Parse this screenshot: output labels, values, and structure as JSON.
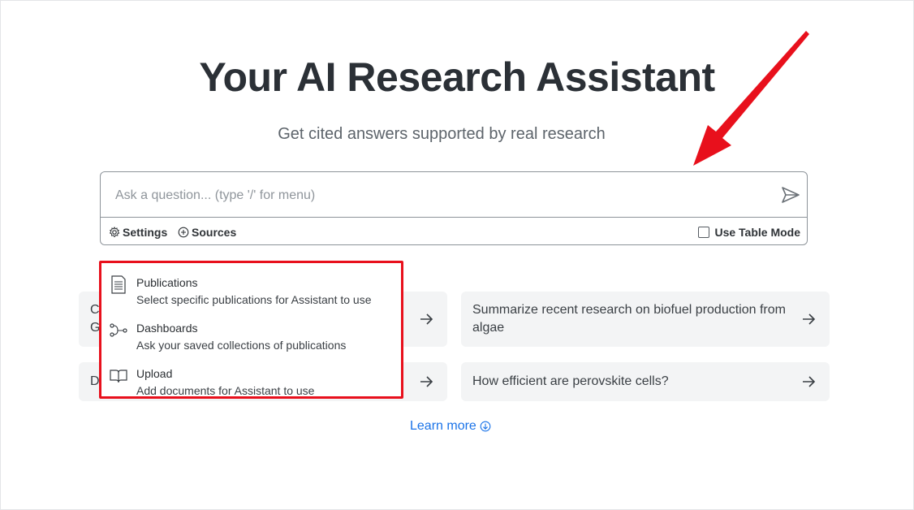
{
  "header": {
    "title": "Your AI Research Assistant",
    "subtitle": "Get cited answers supported by real research"
  },
  "search": {
    "placeholder": "Ask a question... (type '/' for menu)",
    "settings_label": "Settings",
    "sources_label": "Sources",
    "table_mode_label": "Use Table Mode",
    "table_mode_checked": false
  },
  "menu": {
    "items": [
      {
        "label": "Publications",
        "description": "Select specific publications for Assistant to use",
        "icon": "document-icon"
      },
      {
        "label": "Dashboards",
        "description": "Ask your saved collections of publications",
        "icon": "graph-nodes-icon"
      },
      {
        "label": "Upload",
        "description": "Add documents for Assistant to use",
        "icon": "open-book-icon"
      }
    ]
  },
  "suggestions": [
    {
      "text": "C\nG"
    },
    {
      "text": "Summarize recent research on biofuel production from algae"
    },
    {
      "text": "D"
    },
    {
      "text": "How efficient are perovskite cells?"
    }
  ],
  "learn_more": {
    "label": "Learn more"
  },
  "colors": {
    "accent_link": "#1a73e8",
    "annotation_red": "#e8101c",
    "card_bg": "#f3f4f5"
  }
}
